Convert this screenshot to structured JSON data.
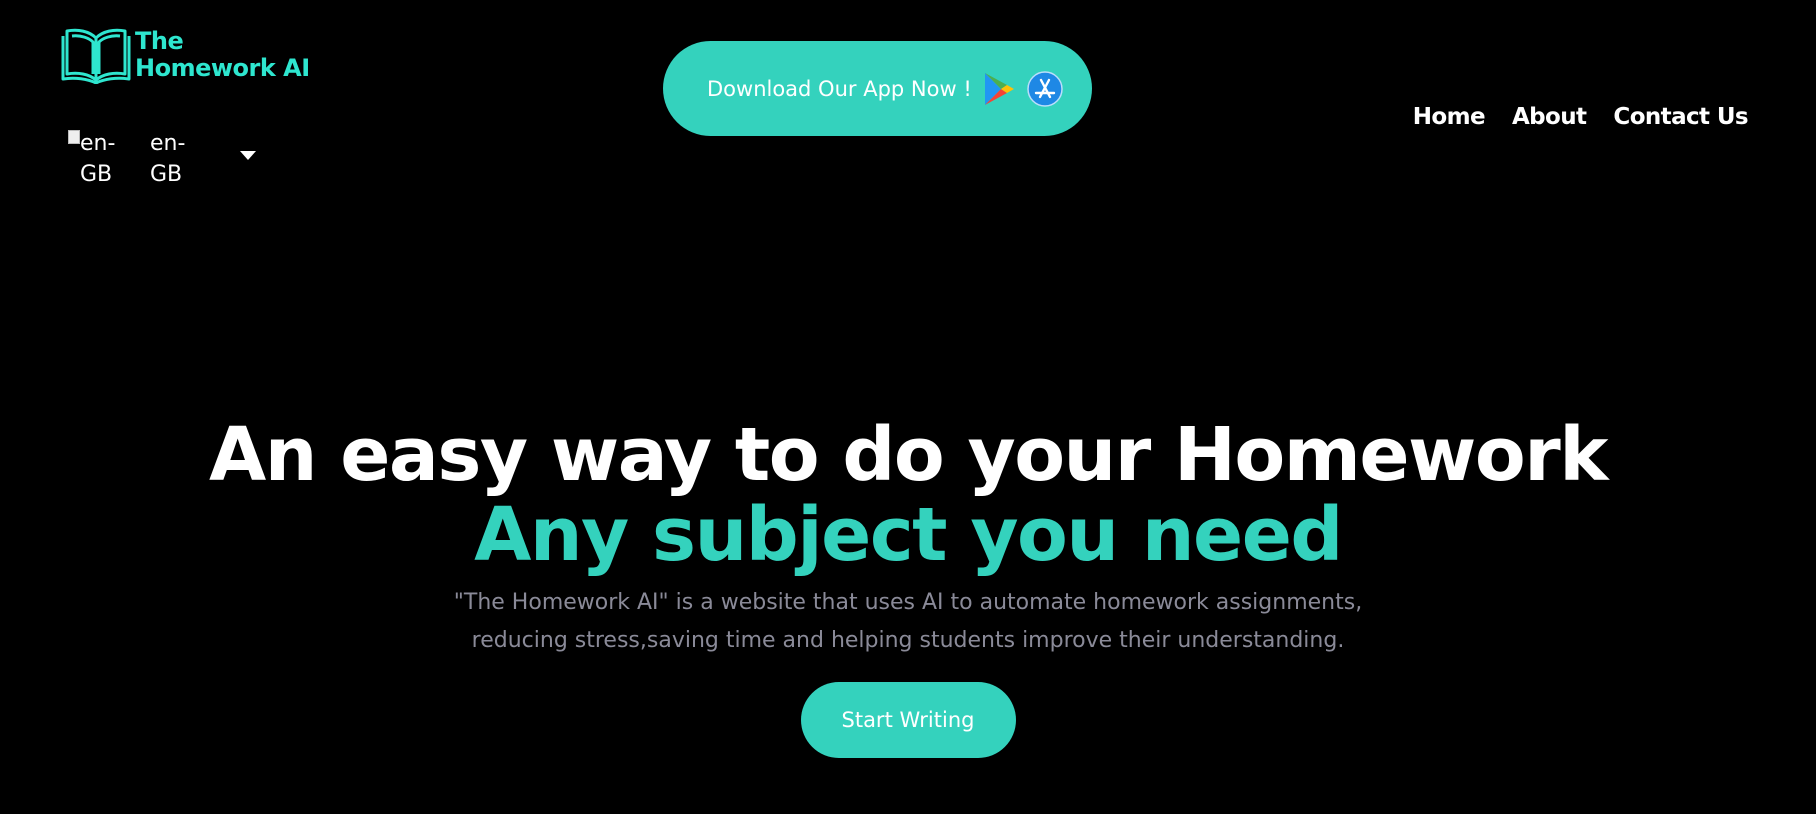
{
  "brand": {
    "line1": "The",
    "line2": "Homework AI",
    "accent_color": "#2ee6cf"
  },
  "language": {
    "flag_alt": "en-GB",
    "selected": "en-GB"
  },
  "download": {
    "label": "Download Our App Now !",
    "icons": [
      "google-play-icon",
      "app-store-icon"
    ],
    "color": "#34d2bd"
  },
  "nav": {
    "items": [
      "Home",
      "About",
      "Contact Us"
    ]
  },
  "hero": {
    "title": "An easy way to do your Homework",
    "subtitle": "Any subject you need",
    "description_line1": "\"The Homework AI\" is a website that uses AI to automate homework assignments,",
    "description_line2": "reducing stress,saving time and helping students improve their understanding.",
    "cta_label": "Start Writing"
  }
}
